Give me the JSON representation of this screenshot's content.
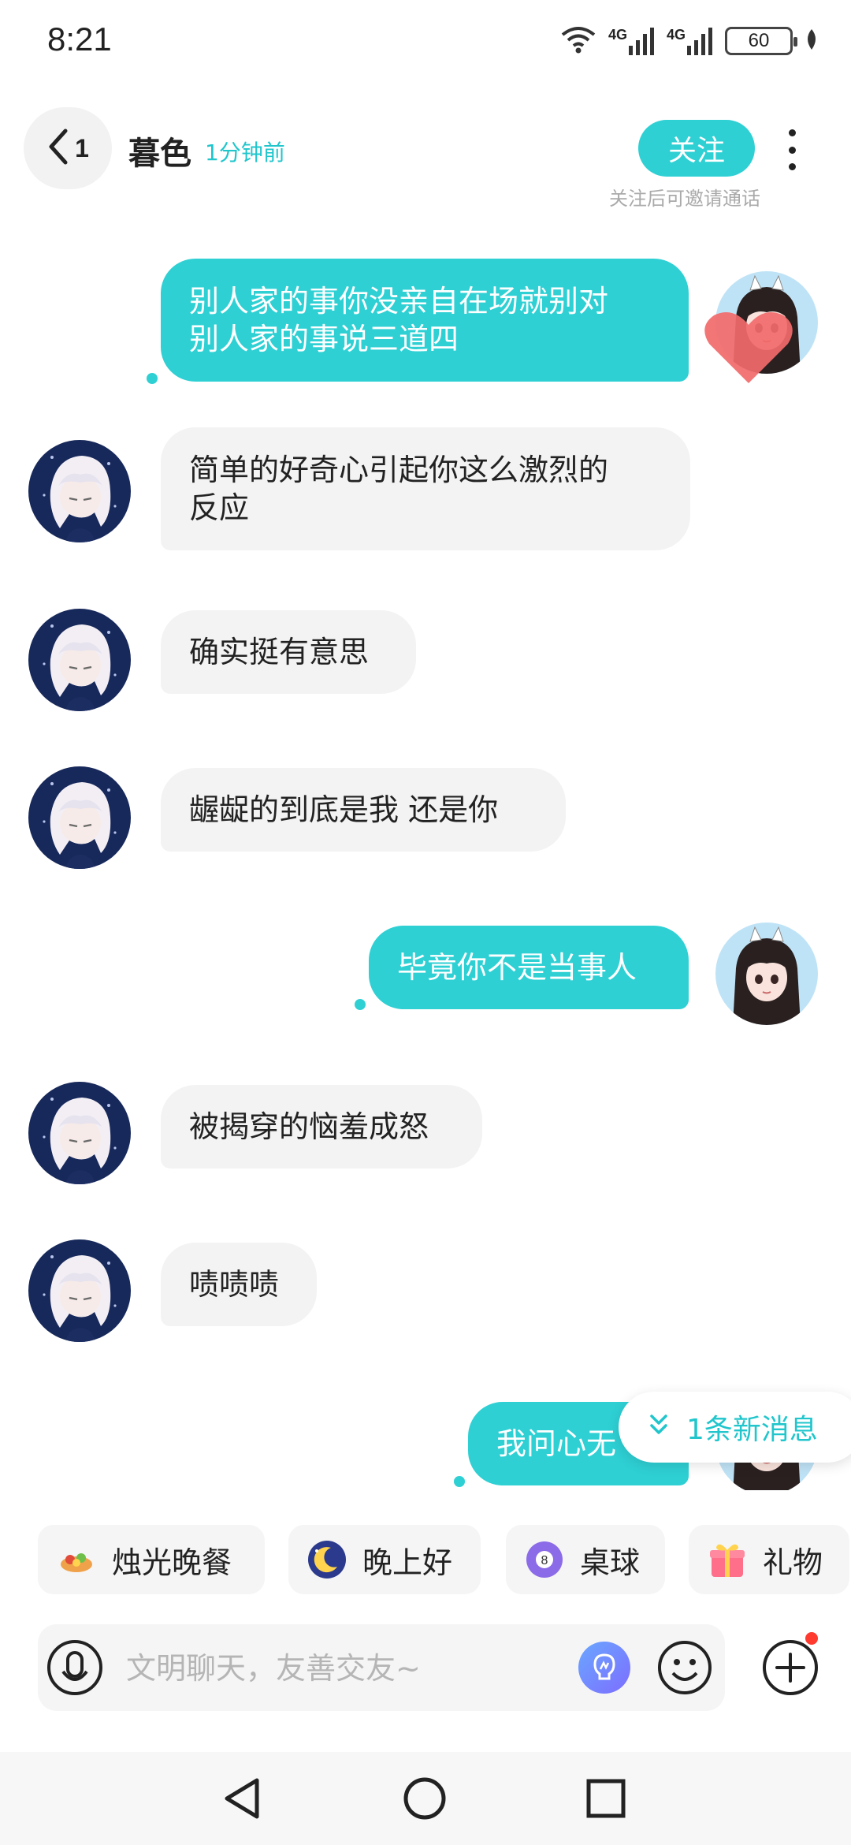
{
  "status_bar": {
    "time": "8:21",
    "battery_level": "60",
    "network_1": "4G",
    "network_2": "4G",
    "icons": [
      "wifi-icon",
      "signal-icon",
      "signal-icon",
      "battery-icon",
      "leaf-icon"
    ]
  },
  "header": {
    "back_count": "1",
    "contact_name": "暮色",
    "last_seen": "1分钟前",
    "follow_label": "关注",
    "follow_hint": "关注后可邀请通话"
  },
  "messages": [
    {
      "side": "out",
      "lines": [
        "别人家的事你没亲自在场就别对",
        "别人家的事说三道四"
      ]
    },
    {
      "side": "in",
      "lines": [
        "简单的好奇心引起你这么激烈的",
        "反应"
      ]
    },
    {
      "side": "in",
      "lines": [
        "确实挺有意思"
      ]
    },
    {
      "side": "in",
      "lines": [
        "龌龊的到底是我  还是你"
      ]
    },
    {
      "side": "out",
      "lines": [
        "毕竟你不是当事人"
      ]
    },
    {
      "side": "in",
      "lines": [
        "被揭穿的恼羞成怒"
      ]
    },
    {
      "side": "in",
      "lines": [
        "啧啧啧"
      ]
    },
    {
      "side": "out",
      "lines": [
        "我问心无"
      ]
    }
  ],
  "new_message_label": "1条新消息",
  "quick_chips": [
    {
      "label": "烛光晚餐",
      "icon": "dinner-icon"
    },
    {
      "label": "晚上好",
      "icon": "moon-icon"
    },
    {
      "label": "桌球",
      "icon": "billiard-ball-icon"
    },
    {
      "label": "礼物",
      "icon": "gift-icon"
    }
  ],
  "input": {
    "placeholder": "文明聊天，友善交友~",
    "value": ""
  },
  "colors": {
    "accent": "#2ed0d4",
    "accent_text": "#20c6cc",
    "incoming_bubble": "#f3f3f3",
    "notification_dot": "#ff3b30"
  }
}
